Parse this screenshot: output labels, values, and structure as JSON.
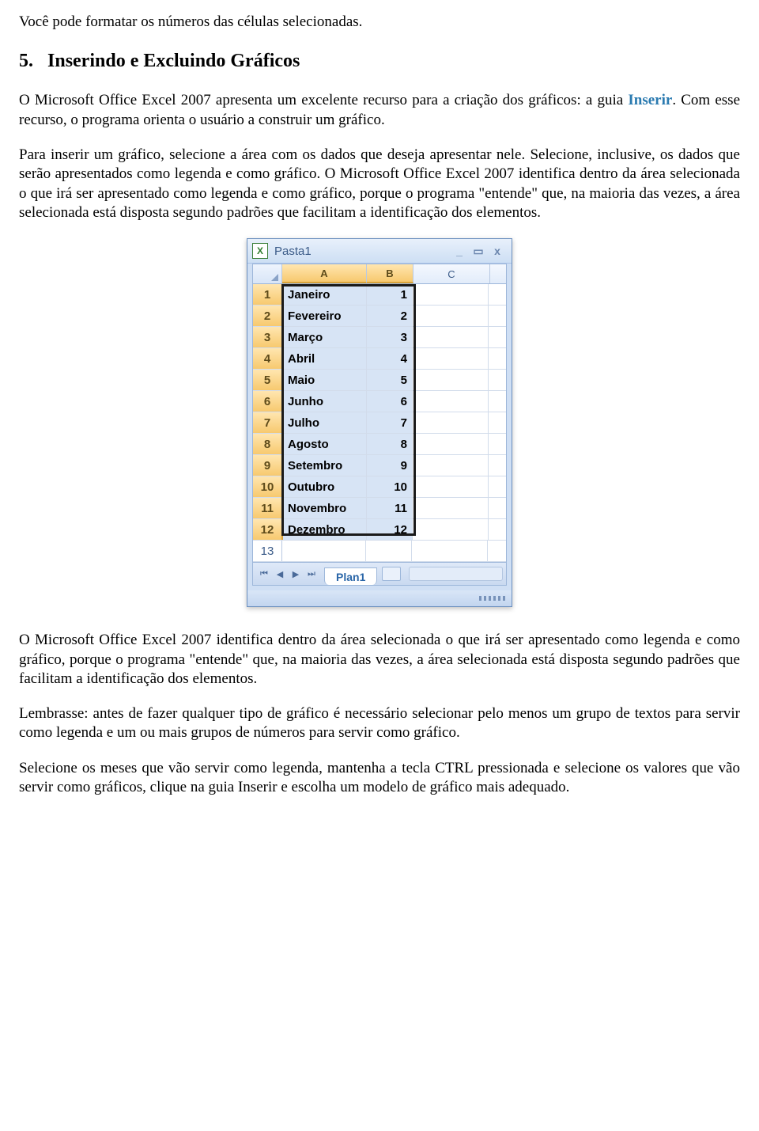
{
  "paragraphs": {
    "p1": "Você pode formatar os números das células selecionadas.",
    "section_number": "5.",
    "section_title": "Inserindo e Excluindo Gráficos",
    "p2a": "O Microsoft Office Excel 2007 apresenta um excelente recurso para a criação dos gráficos: a guia ",
    "inserir": "Inserir",
    "p2b": ". Com esse recurso, o programa orienta o usuário a construir um gráfico.",
    "p3": "Para inserir um gráfico, selecione a área com os dados que deseja apresentar nele. Selecione, inclusive, os dados que serão apresentados como legenda e como gráfico. O Microsoft Office Excel 2007 identifica dentro da área selecionada o que irá ser apresentado como legenda e como gráfico, porque o programa \"entende\" que, na maioria das vezes, a área selecionada está disposta segundo padrões que facilitam a identificação dos elementos.",
    "p4": "O Microsoft Office Excel 2007 identifica dentro da área selecionada o que irá ser apresentado como legenda e como gráfico, porque o programa \"entende\" que, na maioria das vezes, a área selecionada está disposta segundo padrões que facilitam a identificação dos elementos.",
    "p5": "Lembrasse: antes de fazer qualquer tipo de gráfico é necessário selecionar pelo menos um grupo de textos para servir como legenda e um ou mais grupos de números para servir como gráfico.",
    "p6": "Selecione os meses que vão servir como legenda, mantenha a tecla CTRL pressionada e selecione os valores que vão servir como gráficos, clique na guia Inserir e escolha um modelo de gráfico mais adequado."
  },
  "excel": {
    "workbook_title": "Pasta1",
    "columns": {
      "A": "A",
      "B": "B",
      "C": "C"
    },
    "rows": [
      {
        "n": "1",
        "a": "Janeiro",
        "b": "1"
      },
      {
        "n": "2",
        "a": "Fevereiro",
        "b": "2"
      },
      {
        "n": "3",
        "a": "Março",
        "b": "3"
      },
      {
        "n": "4",
        "a": "Abril",
        "b": "4"
      },
      {
        "n": "5",
        "a": "Maio",
        "b": "5"
      },
      {
        "n": "6",
        "a": "Junho",
        "b": "6"
      },
      {
        "n": "7",
        "a": "Julho",
        "b": "7"
      },
      {
        "n": "8",
        "a": "Agosto",
        "b": "8"
      },
      {
        "n": "9",
        "a": "Setembro",
        "b": "9"
      },
      {
        "n": "10",
        "a": "Outubro",
        "b": "10"
      },
      {
        "n": "11",
        "a": "Novembro",
        "b": "11"
      },
      {
        "n": "12",
        "a": "Dezembro",
        "b": "12"
      }
    ],
    "empty_row": "13",
    "sheet_tab": "Plan1",
    "win_buttons": {
      "min": "_",
      "max": "▭",
      "close": "x"
    },
    "nav": {
      "first": "⏮",
      "prev": "◀",
      "next": "▶",
      "last": "⏭"
    }
  }
}
